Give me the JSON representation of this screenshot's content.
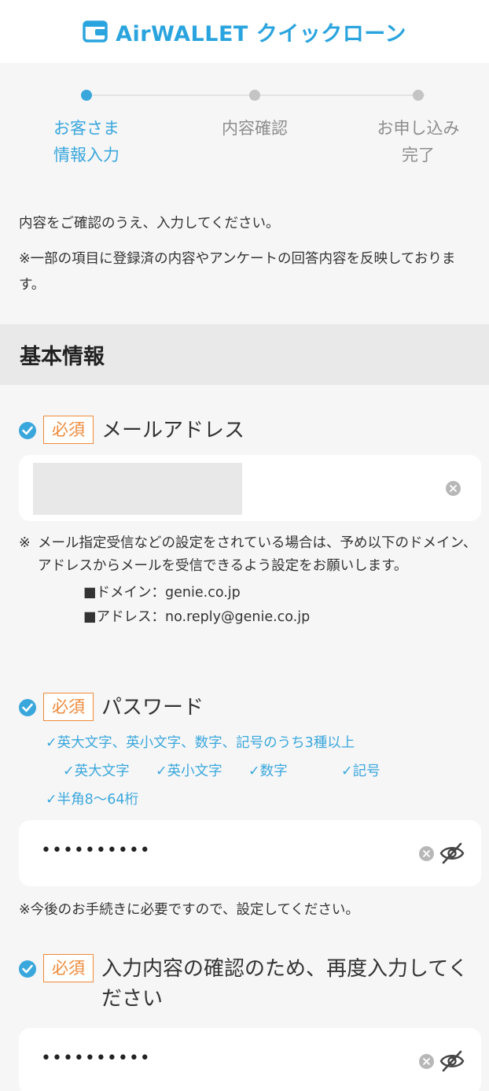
{
  "header": {
    "logo_text": "AirWALLET クイックローン"
  },
  "stepper": {
    "steps": [
      {
        "line1": "お客さま",
        "line2": "情報入力",
        "active": true
      },
      {
        "line1": "内容確認",
        "line2": "",
        "active": false
      },
      {
        "line1": "お申し込み",
        "line2": "完了",
        "active": false
      }
    ]
  },
  "intro": {
    "line1": "内容をご確認のうえ、入力してください。",
    "line2": "※一部の項目に登録済の内容やアンケートの回答内容を反映しております。"
  },
  "section": {
    "title": "基本情報"
  },
  "email": {
    "badge": "必須",
    "label": "メールアドレス",
    "note_mark": "※",
    "note": "メール指定受信などの設定をされている場合は、予め以下のドメイン、アドレスからメールを受信できるよう設定をお願いします。",
    "domain_line": "■ドメイン：genie.co.jp",
    "address_line": "■アドレス：no.reply@genie.co.jp"
  },
  "password": {
    "badge": "必須",
    "label": "パスワード",
    "rule_main": "✓英大文字、英小文字、数字、記号のうち3種以上",
    "rule_upper": "✓英大文字",
    "rule_lower": "✓英小文字",
    "rule_digit": "✓数字",
    "rule_symbol": "✓記号",
    "rule_length": "✓半角8〜64桁",
    "value": "••••••••••",
    "note": "※今後のお手続きに必要ですので、設定してください。"
  },
  "password_confirm": {
    "badge": "必須",
    "label": "入力内容の確認のため、再度入力してください",
    "value": "••••••••••"
  },
  "colors": {
    "accent": "#3aa7dc",
    "required": "#ee8a3a"
  }
}
